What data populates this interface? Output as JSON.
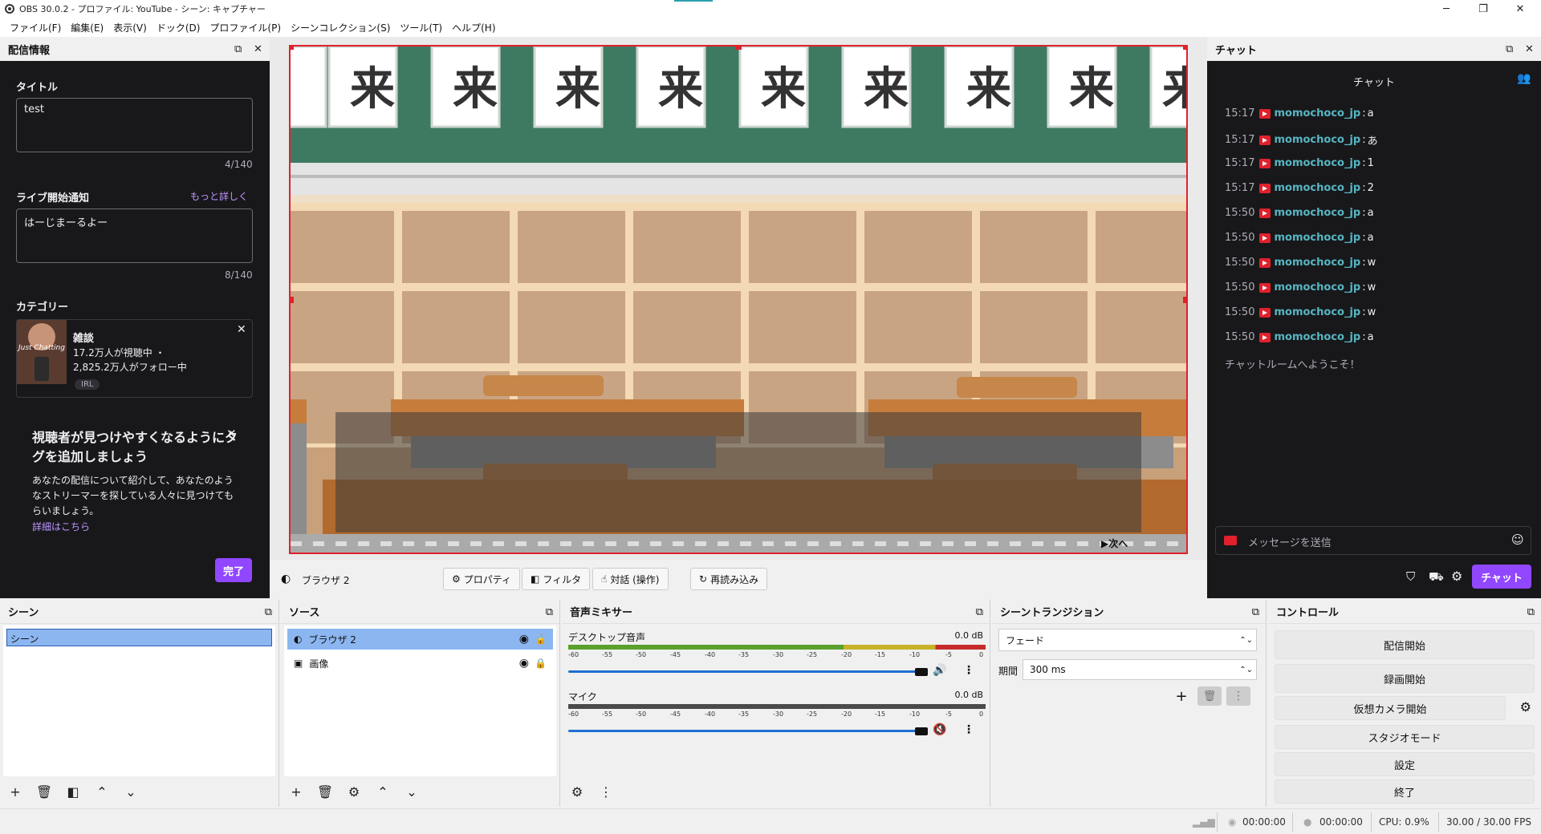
{
  "window": {
    "title": "OBS 30.0.2 - プロファイル: YouTube - シーン: キャプチャー",
    "minimize": "─",
    "maximize": "❐",
    "close": "✕"
  },
  "menu": [
    "ファイル(F)",
    "編集(E)",
    "表示(V)",
    "ドック(D)",
    "プロファイル(P)",
    "シーンコレクション(S)",
    "ツール(T)",
    "ヘルプ(H)"
  ],
  "stream_info": {
    "dock_title": "配信情報",
    "title_label": "タイトル",
    "title_value": "test",
    "title_count": "4/140",
    "notify_label": "ライブ開始通知",
    "notify_more": "もっと詳しく",
    "notify_value": "はーじまーるよー",
    "notify_count": "8/140",
    "category_label": "カテゴリー",
    "category": {
      "name": "雑談",
      "viewers": "17.2万人が視聴中 ・",
      "followers": "2,825.2万人がフォロー中",
      "tag": "IRL",
      "thumb_text": "Just Chatting"
    },
    "tag_heading": "視聴者が見つけやすくなるようにタグを追加しましょう",
    "tag_desc": "あなたの配信について紹介して、あなたのようなストリーマーを探している人々に見つけてもらいましょう。",
    "tag_link": "詳細はこちら",
    "done_button": "完了"
  },
  "preview": {
    "next_label": "▶次へ",
    "banner_char": "来"
  },
  "source_toolbar": {
    "source_name": "ブラウザ 2",
    "properties": "プロパティ",
    "filters": "フィルタ",
    "interact": "対話 (操作)",
    "reload": "再読み込み"
  },
  "chat": {
    "dock_title": "チャット",
    "header": "チャット",
    "messages": [
      {
        "time": "15:17",
        "user": "momochoco_jp",
        "text": "a"
      },
      {
        "time": "15:17",
        "user": "momochoco_jp",
        "text": "あ"
      },
      {
        "time": "15:17",
        "user": "momochoco_jp",
        "text": "1"
      },
      {
        "time": "15:17",
        "user": "momochoco_jp",
        "text": "2"
      },
      {
        "time": "15:50",
        "user": "momochoco_jp",
        "text": "a"
      },
      {
        "time": "15:50",
        "user": "momochoco_jp",
        "text": "a"
      },
      {
        "time": "15:50",
        "user": "momochoco_jp",
        "text": "w"
      },
      {
        "time": "15:50",
        "user": "momochoco_jp",
        "text": "w"
      },
      {
        "time": "15:50",
        "user": "momochoco_jp",
        "text": "w"
      },
      {
        "time": "15:50",
        "user": "momochoco_jp",
        "text": "a"
      }
    ],
    "welcome": "チャットルームへようこそ！",
    "input_placeholder": "メッセージを送信",
    "send_button": "チャット"
  },
  "scenes": {
    "title": "シーン",
    "items": [
      "シーン"
    ]
  },
  "sources": {
    "title": "ソース",
    "items": [
      "ブラウザ 2",
      "画像"
    ]
  },
  "mixer": {
    "title": "音声ミキサー",
    "channels": [
      {
        "name": "デスクトップ音声",
        "db": "0.0 dB",
        "muted": false
      },
      {
        "name": "マイク",
        "db": "0.0 dB",
        "muted": true
      }
    ],
    "ticks": [
      "-60",
      "-55",
      "-50",
      "-45",
      "-40",
      "-35",
      "-30",
      "-25",
      "-20",
      "-15",
      "-10",
      "-5",
      "0"
    ]
  },
  "transitions": {
    "title": "シーントランジション",
    "type": "フェード",
    "duration_label": "期間",
    "duration": "300 ms"
  },
  "controls": {
    "title": "コントロール",
    "start_stream": "配信開始",
    "start_record": "録画開始",
    "start_vcam": "仮想カメラ開始",
    "studio_mode": "スタジオモード",
    "settings": "設定",
    "exit": "終了"
  },
  "status": {
    "stream_time": "00:00:00",
    "record_time": "00:00:00",
    "cpu": "CPU: 0.9%",
    "fps": "30.00 / 30.00 FPS"
  },
  "colors": {
    "accent_purple": "#9147ff",
    "selection_blue": "#8cb6f0",
    "outline_red": "#e0212b",
    "chat_user": "#56b6c2"
  }
}
